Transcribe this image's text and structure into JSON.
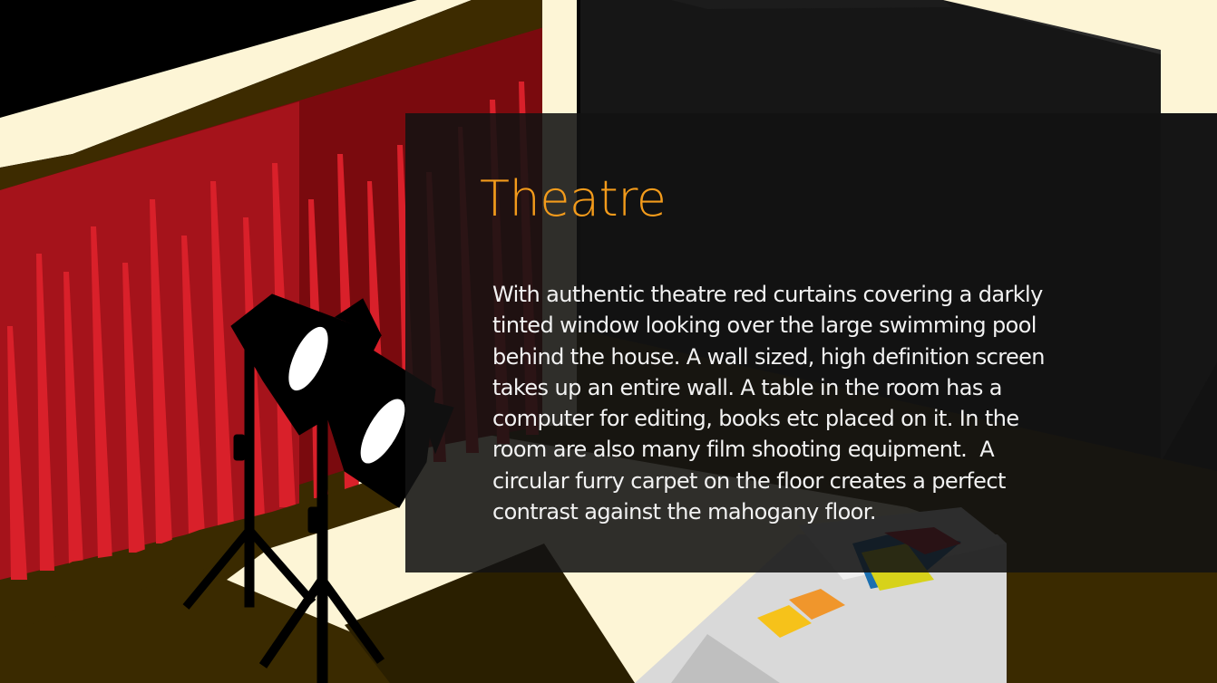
{
  "slide": {
    "title": "Theatre",
    "body": "With authentic theatre red curtains covering a darkly\ntinted window looking over the large swimming pool\nbehind the house. A wall sized, high definition screen\ntakes up an entire wall. A table in the room has a\ncomputer for editing, books etc placed on it. In the\nroom are also many film shooting equipment.  A\ncircular furry carpet on the floor creates a perfect\ncontrast against the mahogany floor."
  },
  "colors": {
    "title": "#f39b1b",
    "body_text": "#f2f2f2",
    "curtain": "#b5141c",
    "frame": "#fdf5d6",
    "floor": "#3a2a00"
  }
}
